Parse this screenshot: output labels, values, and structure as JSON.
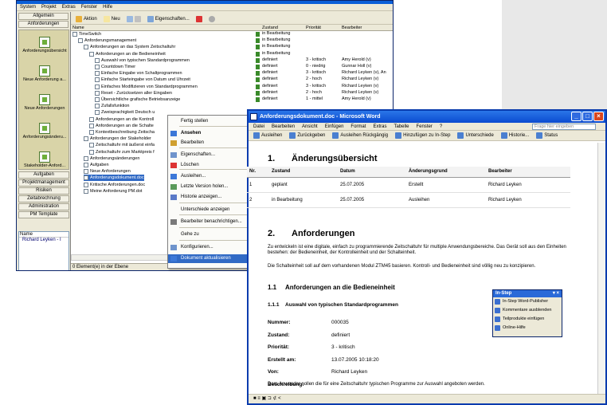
{
  "app": {
    "menu": [
      "System",
      "Projekt",
      "Extras",
      "Fenster",
      "Hilfe"
    ],
    "toolbar": {
      "aktion": "Aktion",
      "neu": "Neu",
      "eigenschaften": "Eigenschaften..."
    },
    "leftbar": {
      "top_heads": [
        "Allgemein",
        "Anforderungen"
      ],
      "items": [
        "Anforderungsübersicht",
        "Neue Anforderung a...",
        "Neue Anforderungen",
        "Anforderungsänderu...",
        "Stakeholder-Anford..."
      ],
      "bottom_heads": [
        "Aufgaben",
        "Projektmanagement",
        "Risiken",
        "Zeitabrechnung",
        "Administration",
        "PM Template"
      ],
      "name_header": "Name",
      "name_value": "Richard Leyken - I"
    },
    "columns": {
      "name": "Name",
      "zustand": "Zustand",
      "prioritaet": "Priorität",
      "bearbeiter": "Bearbeiter"
    },
    "tree": [
      {
        "label": "TimeSwitch",
        "indent": 0
      },
      {
        "label": "Anforderungsmanagement",
        "indent": 1
      },
      {
        "label": "Anforderungen an das System Zeitschaltuhr",
        "indent": 2
      },
      {
        "label": "Anforderungen an die Bedieneinheit",
        "indent": 3
      },
      {
        "label": "Auswahl von typischen Standardprogrammen",
        "indent": 4
      },
      {
        "label": "Countdown Timer",
        "indent": 4
      },
      {
        "label": "Einfache Eingabe von Schaltprogrammen",
        "indent": 4
      },
      {
        "label": "Einfache Starteingabe von Datum und Uhrzeit",
        "indent": 4
      },
      {
        "label": "Einfaches Modifizieren von Standardprogrammen",
        "indent": 4
      },
      {
        "label": "Reset - Zurücksetzen aller Eingaben",
        "indent": 4
      },
      {
        "label": "Übersichtliche grafische Betriebsanzeige",
        "indent": 4
      },
      {
        "label": "Zufallsfunktion",
        "indent": 4
      },
      {
        "label": "Zweisprachigkeit Deutsch u",
        "indent": 4
      },
      {
        "label": "Anforderungen an die Kontroll",
        "indent": 3
      },
      {
        "label": "Anforderungen an die Schalte",
        "indent": 3
      },
      {
        "label": "Kontextbeschreibung Zeitscha",
        "indent": 3
      },
      {
        "label": "Anforderungen der Stakeholder",
        "indent": 2
      },
      {
        "label": "Zeitschaltuhr mit äußerst einfa",
        "indent": 3
      },
      {
        "label": "Zeitschaltuhr zum Marktpreis f",
        "indent": 3
      },
      {
        "label": "Anforderungsänderungen",
        "indent": 2
      },
      {
        "label": "Aufgaben",
        "indent": 2
      },
      {
        "label": "Neue Anforderungen",
        "indent": 2
      },
      {
        "label": "Anforderungsdokument.doc",
        "indent": 2,
        "selected": true
      },
      {
        "label": "Kritische Anforderungen.doc",
        "indent": 2
      },
      {
        "label": "Meine Anforderung PM.dot",
        "indent": 2
      }
    ],
    "status_rows": [
      {
        "zustand": "in Bearbeitung",
        "prio": "",
        "bearb": ""
      },
      {
        "zustand": "in Bearbeitung",
        "prio": "",
        "bearb": ""
      },
      {
        "zustand": "in Bearbeitung",
        "prio": "",
        "bearb": ""
      },
      {
        "zustand": "in Bearbeitung",
        "prio": "",
        "bearb": ""
      },
      {
        "zustand": "definiert",
        "prio": "3 - kritisch",
        "bearb": "Amy Herold (v)"
      },
      {
        "zustand": "definiert",
        "prio": "0 - niedrig",
        "bearb": "Gunnar Holl (v)"
      },
      {
        "zustand": "definiert",
        "prio": "3 - kritisch",
        "bearb": "Richard Leyken (v), An"
      },
      {
        "zustand": "definiert",
        "prio": "2 - hoch",
        "bearb": "Richard Leyken (v)"
      },
      {
        "zustand": "definiert",
        "prio": "3 - kritisch",
        "bearb": "Richard Leyken (v)"
      },
      {
        "zustand": "definiert",
        "prio": "2 - hoch",
        "bearb": "Richard Leyken (v)"
      },
      {
        "zustand": "definiert",
        "prio": "1 - mittel",
        "bearb": "Amy Herold (v)"
      }
    ],
    "statusbar": "0 Element(e) in der Ebene"
  },
  "context_menu": [
    "Fertig stellen",
    "Ansehen",
    "Bearbeiten",
    "Eigenschaften...",
    "Löschen",
    "Ausleihen...",
    "Letzte Version holen...",
    "Historie anzeigen...",
    "Unterschiede anzeigen",
    "Bearbeiter benachrichtigen...",
    "Gehe zu",
    "Konfigurieren...",
    "Dokument aktualisieren"
  ],
  "word": {
    "title": "Anforderungsdokument.doc - Microsoft Word",
    "menu": [
      "Datei",
      "Bearbeiten",
      "Ansicht",
      "Einfügen",
      "Format",
      "Extras",
      "Tabelle",
      "Fenster",
      "?"
    ],
    "help_placeholder": "Frage hier eingeben",
    "toolbar": [
      "Ausleihen",
      "Zurückgeben",
      "Ausleihen Rückgängig",
      "Hinzufügen zu In-Step",
      "Unterschiede",
      "Historie...",
      "Status"
    ],
    "sec1": {
      "num": "1.",
      "title": "Änderungsübersicht"
    },
    "table": {
      "headers": [
        "Nr.",
        "Zustand",
        "Datum",
        "Änderungsgrund",
        "Bearbeiter"
      ],
      "rows": [
        [
          "1",
          "geplant",
          "25.07.2005",
          "Erstellt",
          "Richard Leyken"
        ],
        [
          "2",
          "in Bearbeitung",
          "25.07.2005",
          "Ausleihen",
          "Richard Leyken"
        ]
      ]
    },
    "sec2": {
      "num": "2.",
      "title": "Anforderungen"
    },
    "para1": "Zu entwickeln ist eine digitale, einfach zu programmierende Zeitschaltuhr für multiple Anwendungsbereiche. Das Gerät soll aus den Einheiten bestehen: der Bedieneinheit, der Kontrolleinheit und der Schalteinheit.",
    "para2": "Die Schalteinheit soll auf dem vorhandenen Modul ZTM45 basieren. Kontroll- und Bedieneinheit sind völlig neu zu konzipieren.",
    "sec21": {
      "num": "1.1",
      "title": "Anforderungen an die Bedieneinheit"
    },
    "sec211": {
      "num": "1.1.1",
      "title": "Auswahl von typischen Standardprogrammen"
    },
    "fields": [
      {
        "k": "Nummer:",
        "v": "000035"
      },
      {
        "k": "Zustand:",
        "v": "definiert"
      },
      {
        "k": "Priorität:",
        "v": "3 - kritisch"
      },
      {
        "k": "Erstellt am:",
        "v": "13.07.2005 10:18:20"
      },
      {
        "k": "Von:",
        "v": "Richard Leyken"
      },
      {
        "k": "Beschreibung:",
        "v": ""
      }
    ],
    "desc": "Dem Anwender sollen die für eine Zeitschaltuhr typischen Programme zur Auswahl angeboten werden.",
    "status": "■ ≡ ▣ ⊐ ⊄ <"
  },
  "instep": {
    "title": "In-Step",
    "items": [
      "In-Step Word-Publisher",
      "Kommentare ausblenden",
      "Teilprodukte einfügen",
      "Online-Hilfe"
    ]
  }
}
